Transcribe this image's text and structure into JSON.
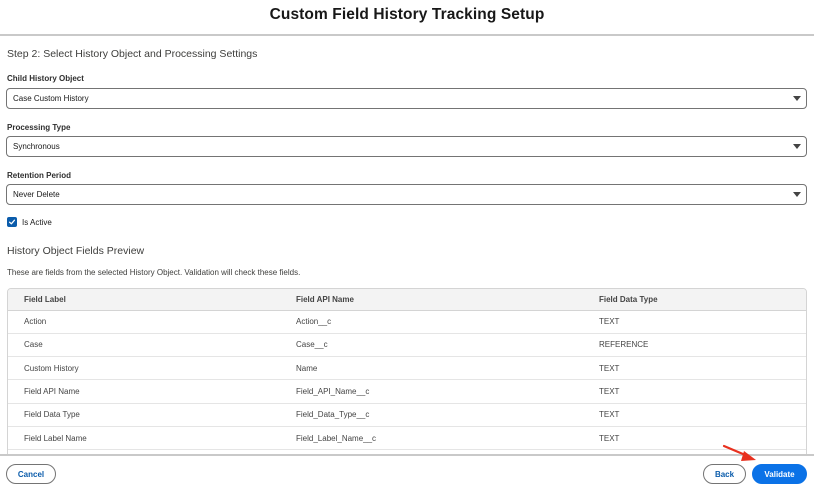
{
  "header": {
    "title": "Custom Field History Tracking Setup"
  },
  "step": {
    "title": "Step 2: Select History Object and Processing Settings"
  },
  "fields": {
    "child_history_object": {
      "label": "Child History Object",
      "value": "Case Custom History"
    },
    "processing_type": {
      "label": "Processing Type",
      "value": "Synchronous"
    },
    "retention_period": {
      "label": "Retention Period",
      "value": "Never Delete"
    }
  },
  "is_active": {
    "label": "Is Active",
    "checked": true
  },
  "preview": {
    "title": "History Object Fields Preview",
    "description": "These are fields from the selected History Object. Validation will check these fields.",
    "columns": [
      "Field Label",
      "Field API Name",
      "Field Data Type"
    ],
    "rows": [
      [
        "Action",
        "Action__c",
        "TEXT"
      ],
      [
        "Case",
        "Case__c",
        "REFERENCE"
      ],
      [
        "Custom History",
        "Name",
        "TEXT"
      ],
      [
        "Field API Name",
        "Field_API_Name__c",
        "TEXT"
      ],
      [
        "Field Data Type",
        "Field_Data_Type__c",
        "TEXT"
      ],
      [
        "Field Label Name",
        "Field_Label_Name__c",
        "TEXT"
      ],
      [
        "",
        "",
        ""
      ]
    ]
  },
  "footer": {
    "cancel_label": "Cancel",
    "back_label": "Back",
    "validate_label": "Validate"
  },
  "colors": {
    "brand": "#0b72e7",
    "link": "#0b5cab",
    "annotation_arrow": "#e8311f"
  }
}
